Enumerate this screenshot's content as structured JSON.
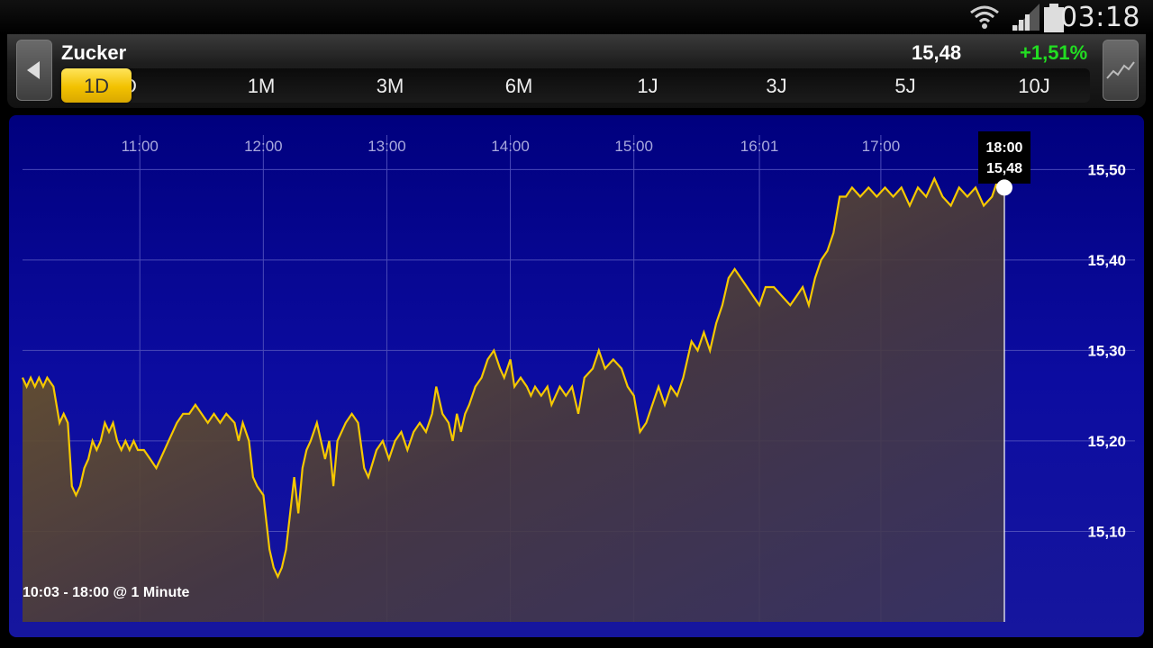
{
  "status_bar": {
    "time": "03:18"
  },
  "header": {
    "title": "Zucker",
    "last_price": "15,48",
    "change": "+1,51%",
    "change_color": "#22dd22"
  },
  "tabs": {
    "selected": "1D",
    "hidden_fragment": "D",
    "items": [
      "1M",
      "3M",
      "6M",
      "1J",
      "3J",
      "5J",
      "10J"
    ]
  },
  "chart_data": {
    "type": "line",
    "series_color": "#f5c800",
    "range_label": "10:03 - 18:00 @ 1 Minute",
    "x_ticks": [
      "11:00",
      "12:00",
      "13:00",
      "14:00",
      "15:00",
      "16:01",
      "17:00"
    ],
    "y_ticks": [
      "15,50",
      "15,40",
      "15,30",
      "15,20",
      "15,10"
    ],
    "ylim": [
      15.0,
      15.56
    ],
    "tooltip": {
      "time": "18:00",
      "value": "15,48"
    },
    "points": [
      [
        "10:03",
        15.27
      ],
      [
        "10:05",
        15.26
      ],
      [
        "10:07",
        15.27
      ],
      [
        "10:09",
        15.26
      ],
      [
        "10:11",
        15.27
      ],
      [
        "10:13",
        15.26
      ],
      [
        "10:15",
        15.27
      ],
      [
        "10:18",
        15.26
      ],
      [
        "10:21",
        15.22
      ],
      [
        "10:23",
        15.23
      ],
      [
        "10:25",
        15.22
      ],
      [
        "10:27",
        15.15
      ],
      [
        "10:29",
        15.14
      ],
      [
        "10:31",
        15.15
      ],
      [
        "10:33",
        15.17
      ],
      [
        "10:35",
        15.18
      ],
      [
        "10:37",
        15.2
      ],
      [
        "10:39",
        15.19
      ],
      [
        "10:41",
        15.2
      ],
      [
        "10:43",
        15.22
      ],
      [
        "10:45",
        15.21
      ],
      [
        "10:47",
        15.22
      ],
      [
        "10:49",
        15.2
      ],
      [
        "10:51",
        15.19
      ],
      [
        "10:53",
        15.2
      ],
      [
        "10:55",
        15.19
      ],
      [
        "10:57",
        15.2
      ],
      [
        "10:59",
        15.19
      ],
      [
        "11:02",
        15.19
      ],
      [
        "11:05",
        15.18
      ],
      [
        "11:08",
        15.17
      ],
      [
        "11:10",
        15.18
      ],
      [
        "11:14",
        15.2
      ],
      [
        "11:18",
        15.22
      ],
      [
        "11:21",
        15.23
      ],
      [
        "11:24",
        15.23
      ],
      [
        "11:27",
        15.24
      ],
      [
        "11:30",
        15.23
      ],
      [
        "11:33",
        15.22
      ],
      [
        "11:36",
        15.23
      ],
      [
        "11:39",
        15.22
      ],
      [
        "11:42",
        15.23
      ],
      [
        "11:46",
        15.22
      ],
      [
        "11:48",
        15.2
      ],
      [
        "11:50",
        15.22
      ],
      [
        "11:53",
        15.2
      ],
      [
        "11:55",
        15.16
      ],
      [
        "11:57",
        15.15
      ],
      [
        "12:00",
        15.14
      ],
      [
        "12:03",
        15.08
      ],
      [
        "12:05",
        15.06
      ],
      [
        "12:07",
        15.05
      ],
      [
        "12:09",
        15.06
      ],
      [
        "12:11",
        15.08
      ],
      [
        "12:13",
        15.12
      ],
      [
        "12:15",
        15.16
      ],
      [
        "12:17",
        15.12
      ],
      [
        "12:19",
        15.17
      ],
      [
        "12:21",
        15.19
      ],
      [
        "12:23",
        15.2
      ],
      [
        "12:26",
        15.22
      ],
      [
        "12:28",
        15.2
      ],
      [
        "12:30",
        15.18
      ],
      [
        "12:32",
        15.2
      ],
      [
        "12:34",
        15.15
      ],
      [
        "12:36",
        15.2
      ],
      [
        "12:40",
        15.22
      ],
      [
        "12:43",
        15.23
      ],
      [
        "12:46",
        15.22
      ],
      [
        "12:49",
        15.17
      ],
      [
        "12:51",
        15.16
      ],
      [
        "12:55",
        15.19
      ],
      [
        "12:58",
        15.2
      ],
      [
        "13:01",
        15.18
      ],
      [
        "13:04",
        15.2
      ],
      [
        "13:07",
        15.21
      ],
      [
        "13:10",
        15.19
      ],
      [
        "13:13",
        15.21
      ],
      [
        "13:16",
        15.22
      ],
      [
        "13:19",
        15.21
      ],
      [
        "13:22",
        15.23
      ],
      [
        "13:24",
        15.26
      ],
      [
        "13:27",
        15.23
      ],
      [
        "13:30",
        15.22
      ],
      [
        "13:32",
        15.2
      ],
      [
        "13:34",
        15.23
      ],
      [
        "13:36",
        15.21
      ],
      [
        "13:38",
        15.23
      ],
      [
        "13:40",
        15.24
      ],
      [
        "13:43",
        15.26
      ],
      [
        "13:46",
        15.27
      ],
      [
        "13:49",
        15.29
      ],
      [
        "13:52",
        15.3
      ],
      [
        "13:55",
        15.28
      ],
      [
        "13:57",
        15.27
      ],
      [
        "14:00",
        15.29
      ],
      [
        "14:02",
        15.26
      ],
      [
        "14:05",
        15.27
      ],
      [
        "14:08",
        15.26
      ],
      [
        "14:10",
        15.25
      ],
      [
        "14:12",
        15.26
      ],
      [
        "14:15",
        15.25
      ],
      [
        "14:18",
        15.26
      ],
      [
        "14:20",
        15.24
      ],
      [
        "14:24",
        15.26
      ],
      [
        "14:27",
        15.25
      ],
      [
        "14:30",
        15.26
      ],
      [
        "14:33",
        15.23
      ],
      [
        "14:36",
        15.27
      ],
      [
        "14:40",
        15.28
      ],
      [
        "14:43",
        15.3
      ],
      [
        "14:46",
        15.28
      ],
      [
        "14:50",
        15.29
      ],
      [
        "14:54",
        15.28
      ],
      [
        "14:57",
        15.26
      ],
      [
        "15:00",
        15.25
      ],
      [
        "15:03",
        15.21
      ],
      [
        "15:06",
        15.22
      ],
      [
        "15:09",
        15.24
      ],
      [
        "15:12",
        15.26
      ],
      [
        "15:15",
        15.24
      ],
      [
        "15:18",
        15.26
      ],
      [
        "15:21",
        15.25
      ],
      [
        "15:24",
        15.27
      ],
      [
        "15:28",
        15.31
      ],
      [
        "15:31",
        15.3
      ],
      [
        "15:34",
        15.32
      ],
      [
        "15:37",
        15.3
      ],
      [
        "15:40",
        15.33
      ],
      [
        "15:43",
        15.35
      ],
      [
        "15:46",
        15.38
      ],
      [
        "15:49",
        15.39
      ],
      [
        "15:52",
        15.38
      ],
      [
        "15:55",
        15.37
      ],
      [
        "15:58",
        15.36
      ],
      [
        "16:01",
        15.35
      ],
      [
        "16:04",
        15.37
      ],
      [
        "16:08",
        15.37
      ],
      [
        "16:12",
        15.36
      ],
      [
        "16:16",
        15.35
      ],
      [
        "16:19",
        15.36
      ],
      [
        "16:22",
        15.37
      ],
      [
        "16:25",
        15.35
      ],
      [
        "16:28",
        15.38
      ],
      [
        "16:31",
        15.4
      ],
      [
        "16:34",
        15.41
      ],
      [
        "16:37",
        15.43
      ],
      [
        "16:40",
        15.47
      ],
      [
        "16:43",
        15.47
      ],
      [
        "16:46",
        15.48
      ],
      [
        "16:50",
        15.47
      ],
      [
        "16:54",
        15.48
      ],
      [
        "16:58",
        15.47
      ],
      [
        "17:02",
        15.48
      ],
      [
        "17:06",
        15.47
      ],
      [
        "17:10",
        15.48
      ],
      [
        "17:14",
        15.46
      ],
      [
        "17:18",
        15.48
      ],
      [
        "17:22",
        15.47
      ],
      [
        "17:26",
        15.49
      ],
      [
        "17:30",
        15.47
      ],
      [
        "17:34",
        15.46
      ],
      [
        "17:38",
        15.48
      ],
      [
        "17:42",
        15.47
      ],
      [
        "17:46",
        15.48
      ],
      [
        "17:50",
        15.46
      ],
      [
        "17:54",
        15.47
      ],
      [
        "17:57",
        15.49
      ],
      [
        "18:00",
        15.48
      ]
    ]
  }
}
